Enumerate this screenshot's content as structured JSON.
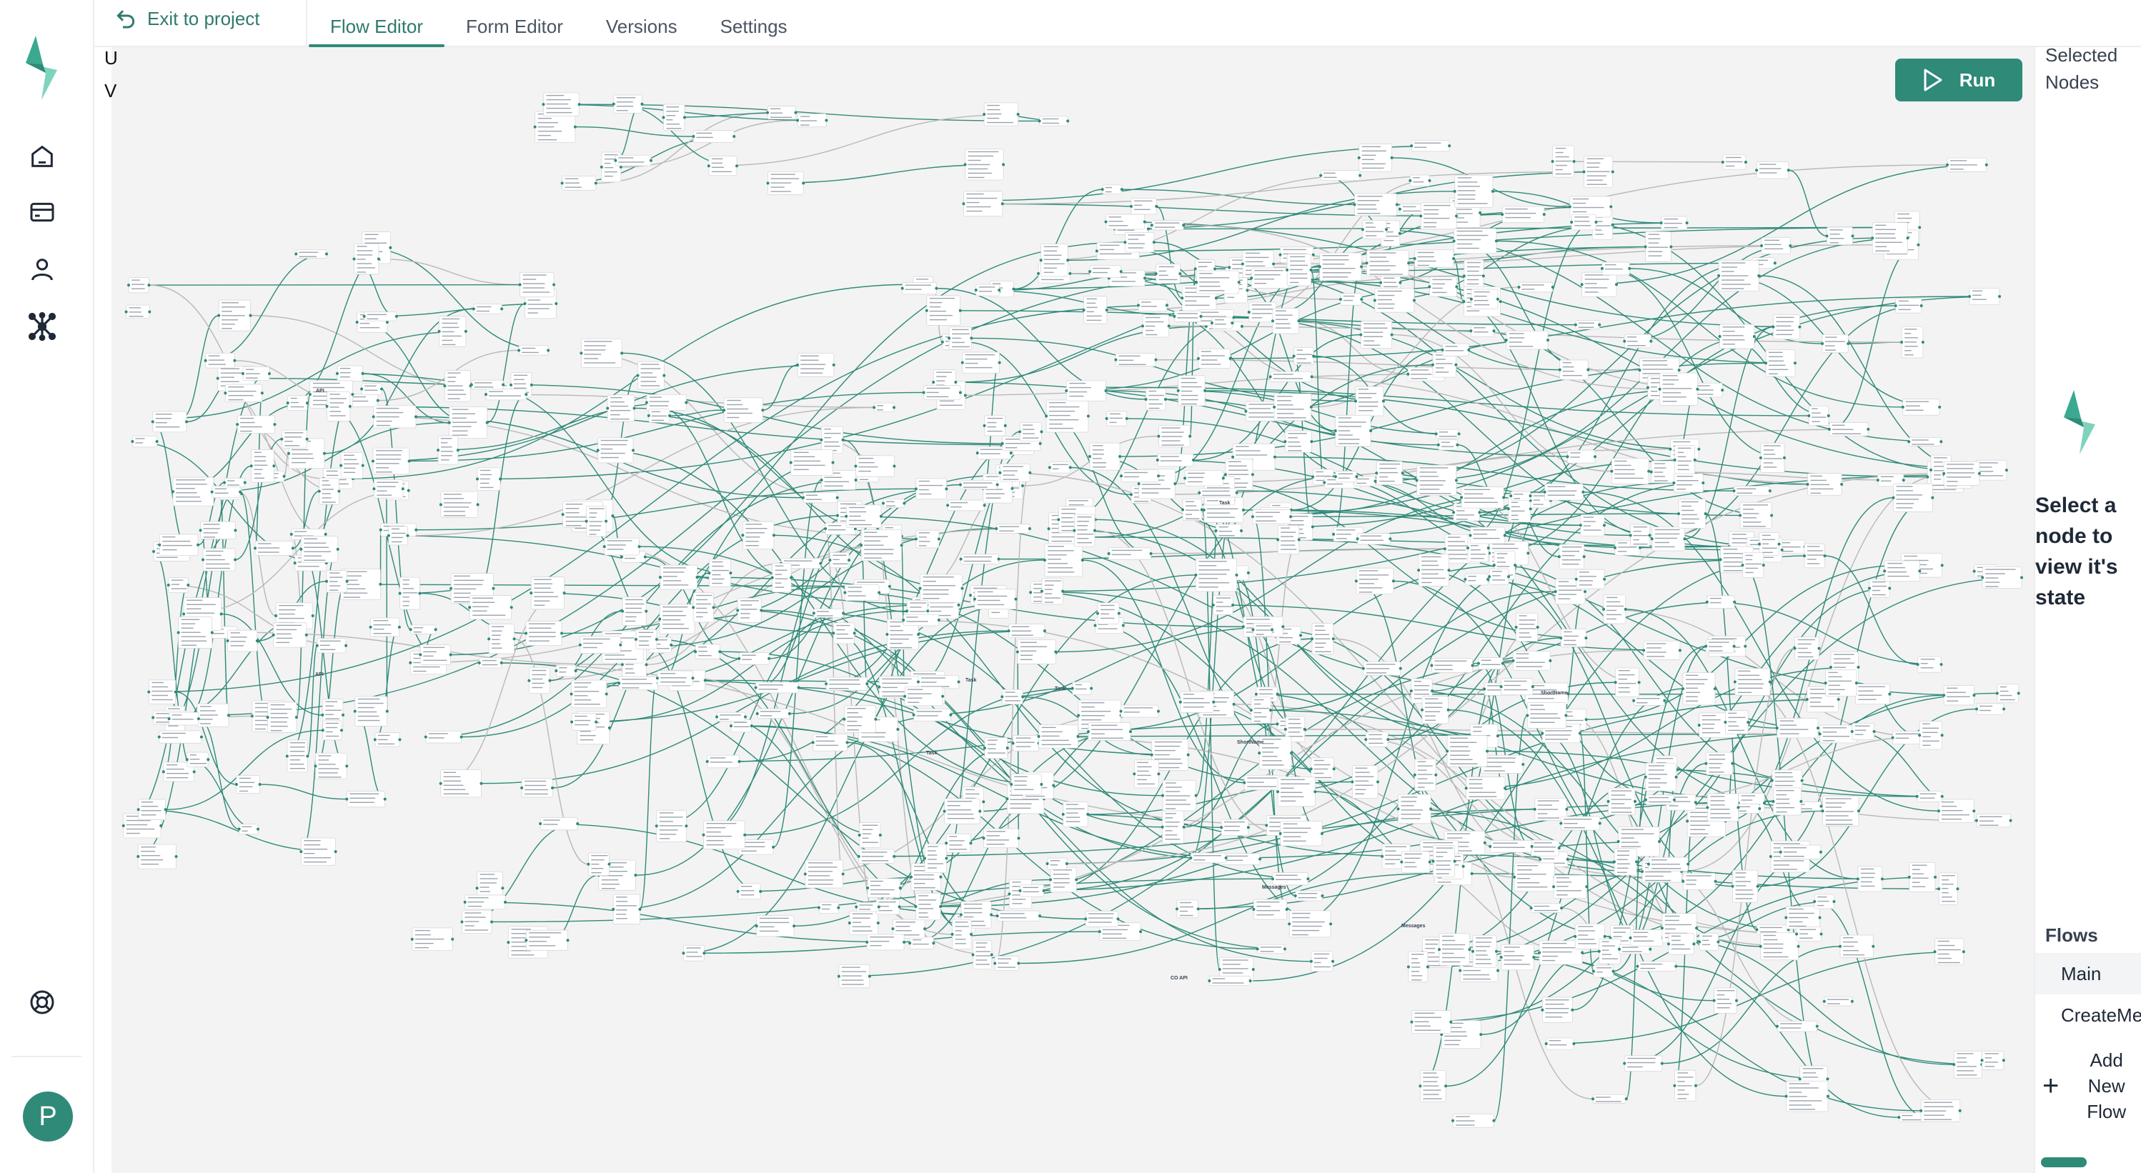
{
  "header": {
    "exit_label": "Exit to project",
    "tabs": [
      {
        "label": "Flow Editor",
        "active": true
      },
      {
        "label": "Form Editor",
        "active": false
      },
      {
        "label": "Versions",
        "active": false
      },
      {
        "label": "Settings",
        "active": false
      }
    ]
  },
  "sidebar": {
    "items": [
      {
        "name": "home-icon"
      },
      {
        "name": "billing-card-icon"
      },
      {
        "name": "user-icon"
      },
      {
        "name": "integrations-network-icon"
      }
    ],
    "help_icon": "lifebuoy-icon",
    "avatar_initial": "P"
  },
  "canvas": {
    "run_label": "Run",
    "clipped_letters": [
      "U",
      "V"
    ],
    "node_labels": [
      "API",
      "API",
      "CO API",
      "Messages",
      "Messages",
      "Task",
      "Task",
      "Task",
      "Task",
      "ShortName",
      "ShortName"
    ]
  },
  "right_panel": {
    "selected_title": "Selected Nodes",
    "state_message": "Select a node to view it's state",
    "flows_title": "Flows",
    "flows": [
      {
        "label": "Main",
        "active": true
      },
      {
        "label": "CreateMe",
        "active": false
      }
    ],
    "add_flow_label": "Add New Flow"
  },
  "colors": {
    "accent": "#2f8a78",
    "canvas_bg": "#f3f3f3",
    "node_bg": "#ffffff",
    "edge": "#2f8a78"
  }
}
